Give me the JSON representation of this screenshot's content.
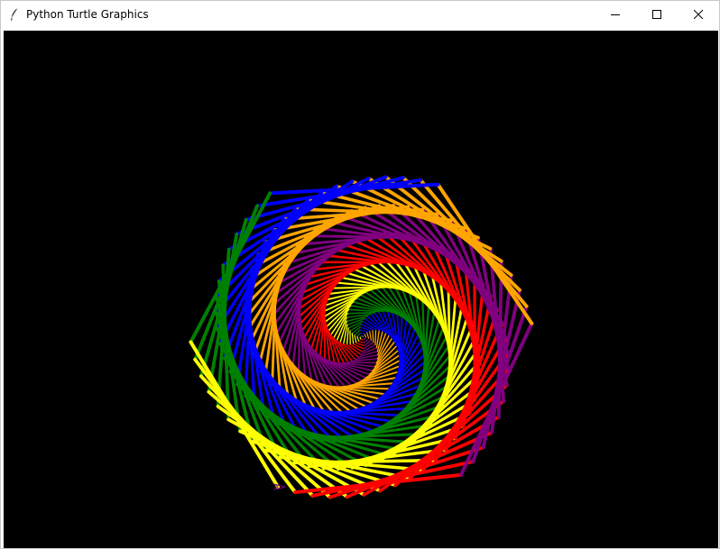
{
  "window": {
    "title": "Python Turtle Graphics",
    "icon": "feather-icon",
    "controls": [
      "minimize-icon",
      "maximize-icon",
      "close-icon"
    ]
  },
  "canvas": {
    "background": "#000000",
    "drawing": "hexagonal-spiral",
    "colors": [
      "#ff0000",
      "#800080",
      "#ffa500",
      "#0000ff",
      "#008000",
      "#ffff00"
    ],
    "turtle_color": "#800080"
  }
}
